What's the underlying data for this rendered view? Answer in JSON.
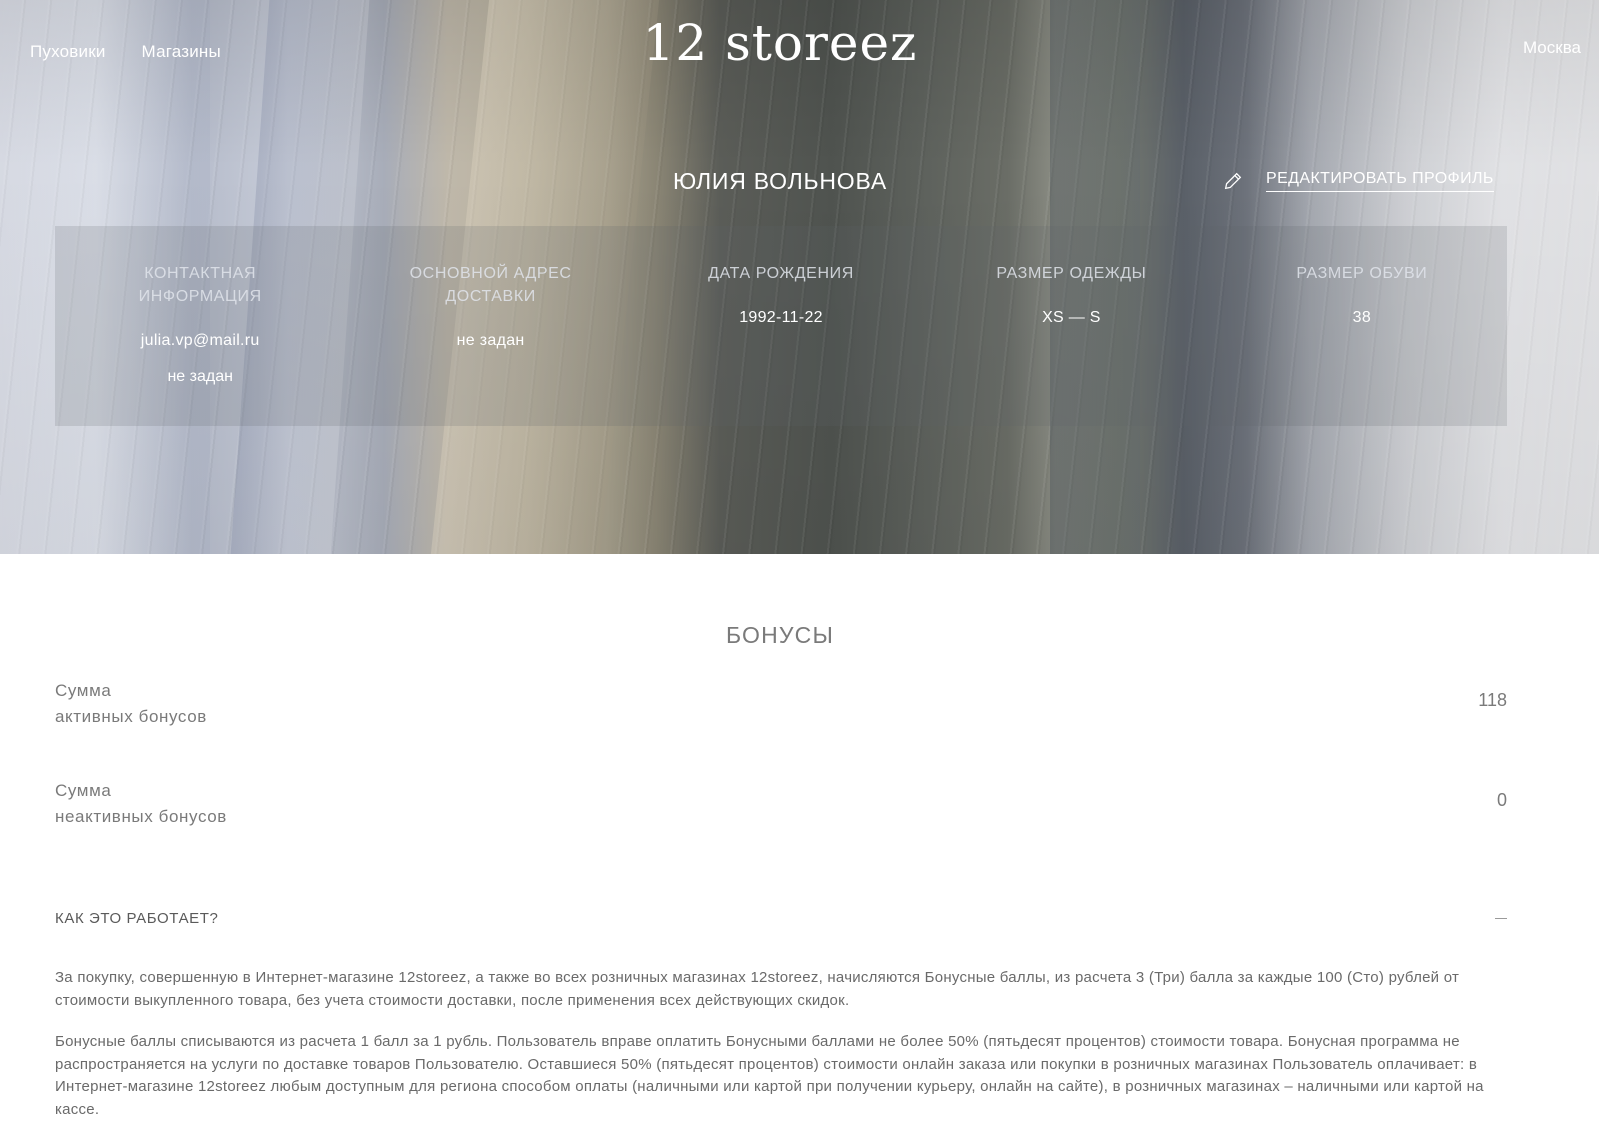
{
  "header": {
    "nav": [
      "Пуховики",
      "Магазины"
    ],
    "logo": "12 storeez",
    "city": "Москва"
  },
  "profile": {
    "name": "ЮЛИЯ ВОЛЬНОВА",
    "edit_label": "РЕДАКТИРОВАТЬ ПРОФИЛЬ",
    "columns": [
      {
        "title": "КОНТАКТНАЯ ИНФОРМАЦИЯ",
        "values": [
          "julia.vp@mail.ru",
          "не задан"
        ]
      },
      {
        "title": "ОСНОВНОЙ АДРЕС ДОСТАВКИ",
        "values": [
          "не задан"
        ]
      },
      {
        "title": "ДАТА РОЖДЕНИЯ",
        "values": [
          "1992-11-22"
        ]
      },
      {
        "title": "РАЗМЕР ОДЕЖДЫ",
        "values": [
          "XS — S"
        ]
      },
      {
        "title": "РАЗМЕР ОБУВИ",
        "values": [
          "38"
        ]
      }
    ]
  },
  "bonuses": {
    "title": "БОНУСЫ",
    "active": {
      "label_line1": "Сумма",
      "label_line2": "активных бонусов",
      "value": "118"
    },
    "inactive": {
      "label_line1": "Сумма",
      "label_line2": "неактивных бонусов",
      "value": "0"
    },
    "how_it_works": "КАК ЭТО РАБОТАЕТ?",
    "paragraphs": [
      "За покупку, совершенную в Интернет-магазине 12storeez, а также во всех розничных магазинах 12storeez, начисляются Бонусные баллы, из расчета 3 (Три) балла за каждые 100 (Сто) рублей от стоимости выкупленного товара, без учета стоимости доставки, после применения всех действующих скидок.",
      "Бонусные баллы списываются из расчета 1 балл за 1 рубль. Пользователь вправе оплатить Бонусными баллами не более 50% (пятьдесят процентов) стоимости товара. Бонусная программа не распространяется на услуги по доставке товаров Пользователю. Оставшиеся 50% (пятьдесят процентов) стоимости онлайн заказа или покупки в розничных магазинах Пользователь оплачивает: в Интернет-магазине 12storeez любым доступным для региона способом оплаты (наличными или картой при получении курьеру, онлайн на сайте), в розничных магазинах – наличными или картой на кассе."
    ]
  }
}
